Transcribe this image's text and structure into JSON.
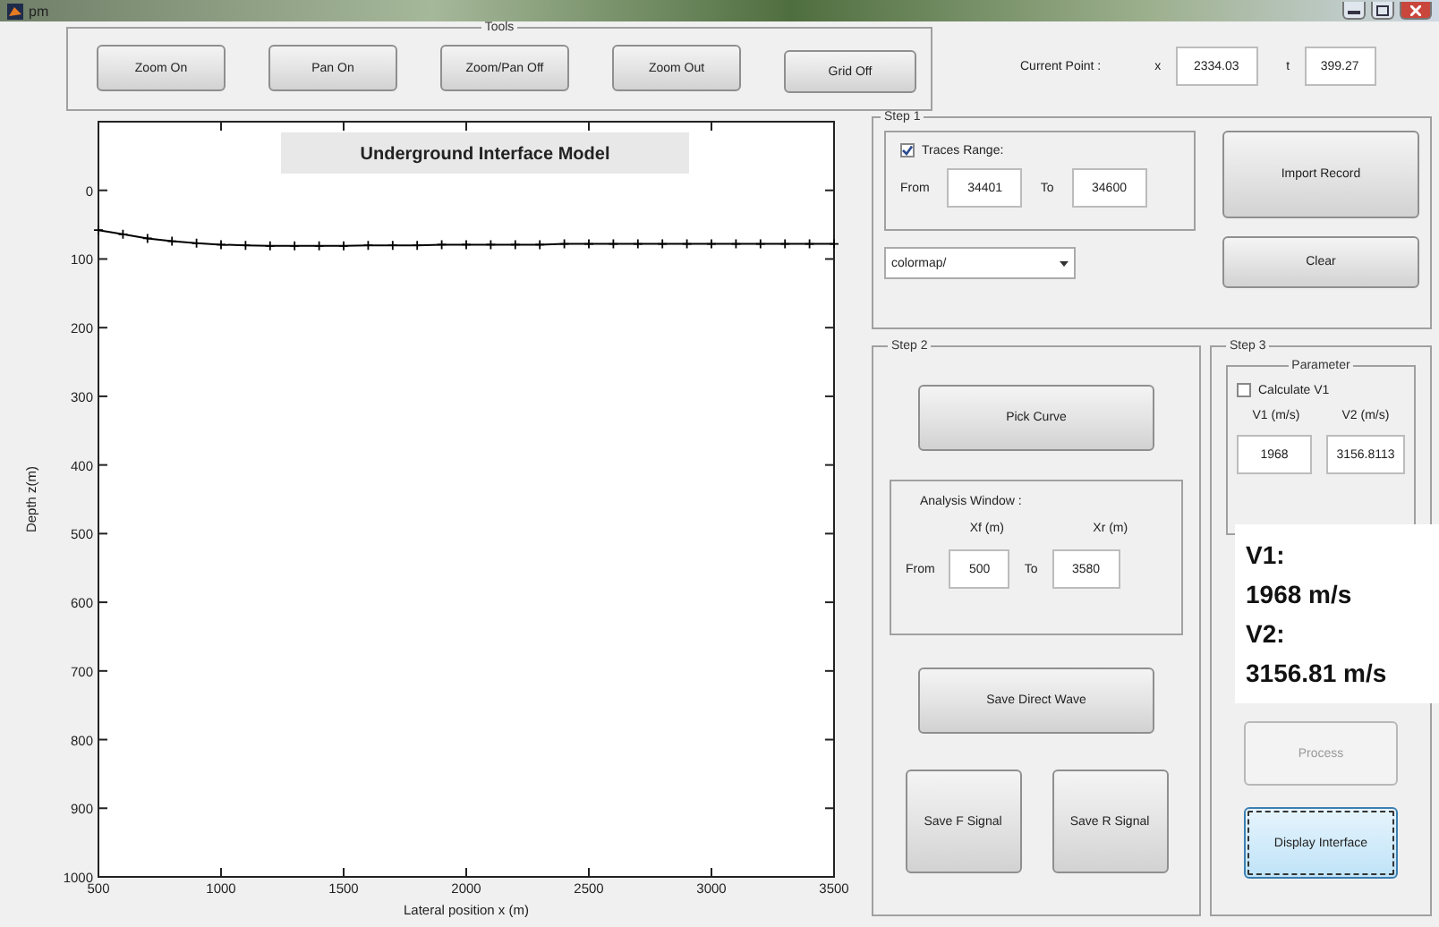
{
  "window": {
    "title": "pm",
    "controls": [
      {
        "kind": "minimize"
      },
      {
        "kind": "maximize"
      },
      {
        "kind": "close"
      }
    ]
  },
  "tools": {
    "title": "Tools",
    "buttons": [
      "Zoom On",
      "Pan On",
      "Zoom/Pan Off",
      "Zoom Out",
      "Grid Off"
    ]
  },
  "plot": {
    "chart_data": {
      "type": "line",
      "title": "Underground Interface Model",
      "xlabel": "Lateral position x (m)",
      "ylabel": "Depth z(m)",
      "xlim": [
        500,
        3500
      ],
      "ylim": [
        1000,
        -100
      ],
      "xticks": [
        500,
        1000,
        1500,
        2000,
        2500,
        3000,
        3500
      ],
      "yticks": [
        0,
        100,
        200,
        300,
        400,
        500,
        600,
        700,
        800,
        900,
        1000
      ],
      "x": [
        500,
        600,
        700,
        800,
        900,
        1000,
        1100,
        1200,
        1300,
        1400,
        1500,
        1600,
        1700,
        1800,
        1900,
        2000,
        2100,
        2200,
        2300,
        2400,
        2500,
        2600,
        2700,
        2800,
        2900,
        3000,
        3100,
        3200,
        3300,
        3400,
        3500
      ],
      "series": [
        {
          "color": "#000000",
          "marker": "plus",
          "values": [
            58,
            64,
            70,
            74,
            77,
            79,
            80,
            81,
            81,
            81,
            81,
            80,
            80,
            80,
            79,
            79,
            79,
            79,
            79,
            78,
            78,
            78,
            78,
            78,
            78,
            78,
            78,
            78,
            78,
            78,
            78
          ]
        }
      ]
    }
  },
  "current_point": {
    "label": "Current Point :",
    "x_label": "x",
    "x_value": "2334.03",
    "t_label": "t",
    "t_value": "399.27"
  },
  "step1": {
    "title": "Step 1",
    "traces_range": {
      "label": "Traces Range:",
      "checked": true,
      "from_label": "From",
      "from_value": "34401",
      "to_label": "To",
      "to_value": "34600"
    },
    "colormap": "colormap/",
    "buttons": [
      "Import Record",
      "Clear"
    ]
  },
  "step2": {
    "title": "Step 2",
    "pick_button": "Pick Curve",
    "analysis_window": {
      "label": "Analysis Window :",
      "xf_label": "Xf (m)",
      "xr_label": "Xr (m)",
      "from_label": "From",
      "from_value": "500",
      "to_label": "To",
      "to_value": "3580"
    },
    "save_direct_button": "Save Direct Wave",
    "signal_buttons": [
      "Save F Signal",
      "Save R Signal"
    ]
  },
  "step3": {
    "title": "Step 3",
    "parameter": {
      "title": "Parameter",
      "calculate_label": "Calculate V1",
      "calculate_checked": false,
      "v1_label": "V1 (m/s)",
      "v2_label": "V2 (m/s)",
      "v1_value": "1968",
      "v2_value": "3156.8113"
    },
    "buttons": [
      {
        "label": "Process",
        "disabled": true,
        "focused": false
      },
      {
        "label": "Display Interface",
        "disabled": false,
        "focused": true
      }
    ]
  },
  "overlay_note": [
    "V1:",
    "1968 m/s",
    "V2:",
    "3156.81 m/s"
  ]
}
